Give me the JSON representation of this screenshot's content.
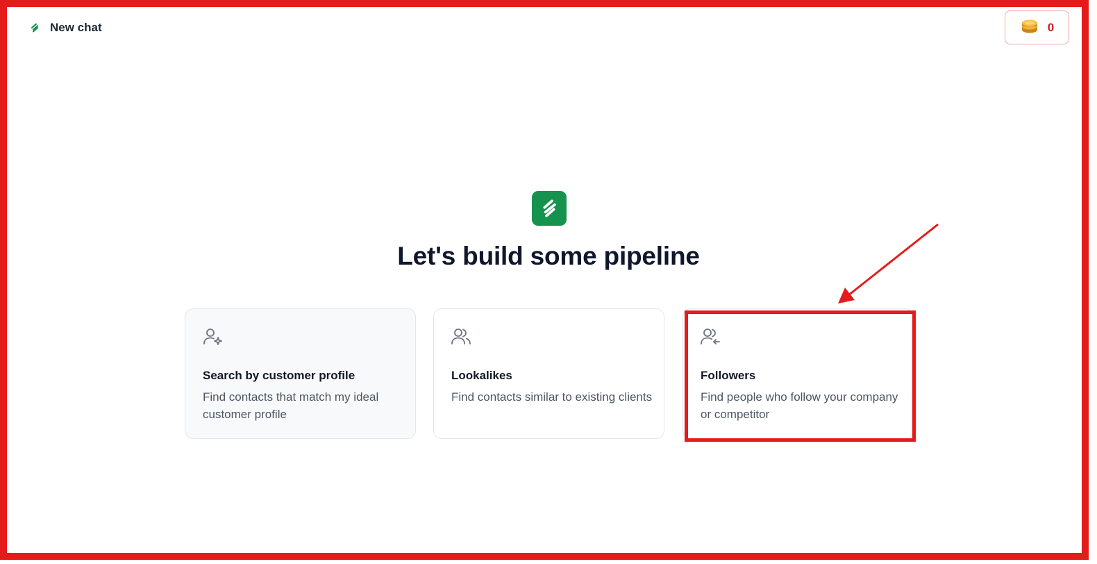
{
  "topbar": {
    "title": "New chat",
    "logo_icon": "brand-logo-icon"
  },
  "credits": {
    "icon": "coins-icon",
    "count": "0"
  },
  "hero": {
    "logo_icon": "brand-logo-icon",
    "headline": "Let's build some pipeline"
  },
  "cards": [
    {
      "icon": "user-sparkle-icon",
      "title": "Search by customer profile",
      "description": "Find contacts that match my ideal customer profile"
    },
    {
      "icon": "users-icon",
      "title": "Lookalikes",
      "description": "Find contacts similar to existing clients"
    },
    {
      "icon": "user-follow-icon",
      "title": "Followers",
      "description": "Find people who follow your company or competitor"
    }
  ],
  "colors": {
    "brand_green": "#16924f",
    "annotation_red": "#e41b1b",
    "credits_red": "#c71f1f"
  }
}
